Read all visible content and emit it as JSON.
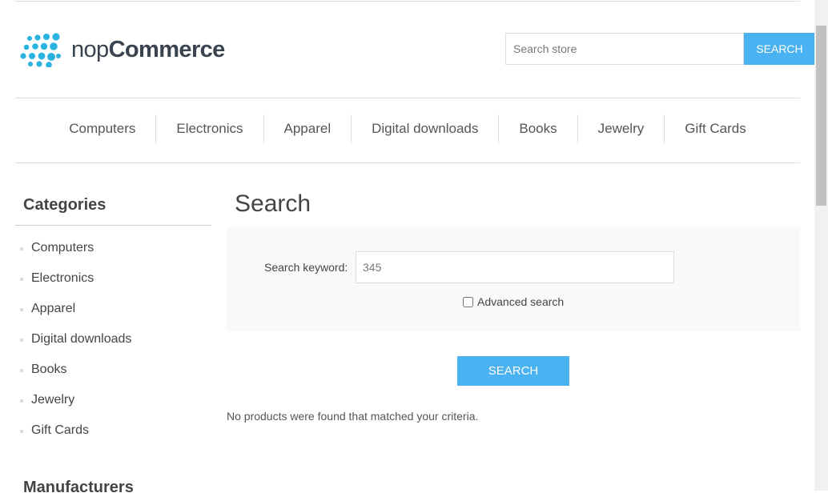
{
  "header": {
    "logo_light": "nop",
    "logo_bold": "Commerce",
    "search_placeholder": "Search store",
    "search_button": "Search"
  },
  "top_menu": [
    "Computers",
    "Electronics",
    "Apparel",
    "Digital downloads",
    "Books",
    "Jewelry",
    "Gift Cards"
  ],
  "sidebar": {
    "categories_title": "Categories",
    "categories": [
      "Computers",
      "Electronics",
      "Apparel",
      "Digital downloads",
      "Books",
      "Jewelry",
      "Gift Cards"
    ],
    "manufacturers_title": "Manufacturers"
  },
  "main": {
    "title": "Search",
    "keyword_label": "Search keyword:",
    "keyword_value": "345",
    "advanced_label": "Advanced search",
    "advanced_checked": false,
    "search_button": "SEARCH",
    "no_result": "No products were found that matched your criteria."
  },
  "colors": {
    "accent": "#4ab2f1",
    "logo_dots": "#2bb3e0"
  }
}
